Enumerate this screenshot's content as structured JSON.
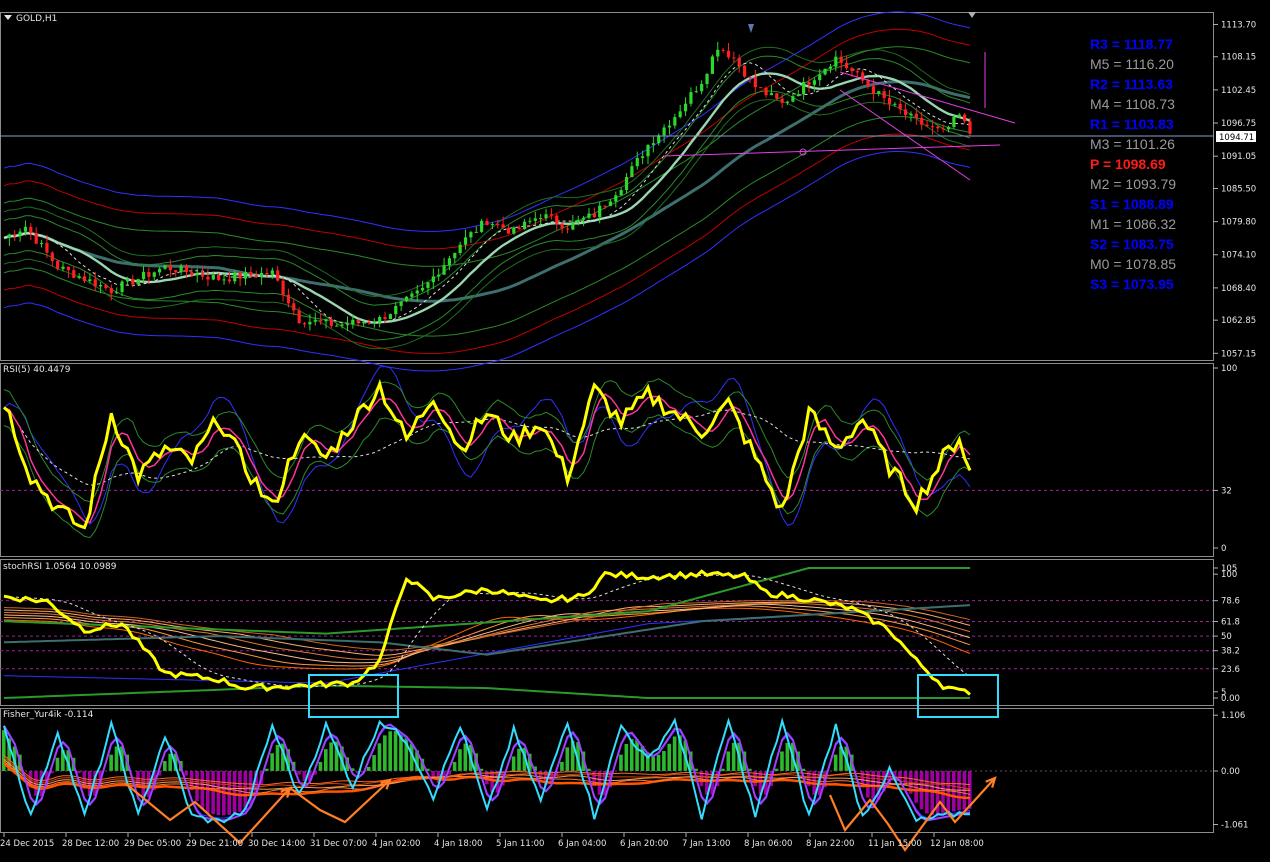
{
  "panes": {
    "main": {
      "title": "GOLD,H1",
      "price_label": "1094.71"
    },
    "rsi": {
      "title": "RSI(5) 40.4479"
    },
    "stoch": {
      "title": "stochRSI 1.0564 10.0989"
    },
    "fisher": {
      "title": "Fisher_Yur4ik -0.114"
    }
  },
  "pivots": [
    {
      "label": "R3 = 1118.77",
      "color": "#0000ff"
    },
    {
      "label": "M5 = 1116.20",
      "color": "#9a9a9a"
    },
    {
      "label": "R2 = 1113.63",
      "color": "#0000ff"
    },
    {
      "label": "M4 = 1108.73",
      "color": "#9a9a9a"
    },
    {
      "label": "R1 = 1103.83",
      "color": "#0000ff"
    },
    {
      "label": "M3 = 1101.26",
      "color": "#9a9a9a"
    },
    {
      "label": "P  = 1098.69",
      "color": "#ff1a1a"
    },
    {
      "label": "M2 = 1093.79",
      "color": "#9a9a9a"
    },
    {
      "label": "S1 = 1088.89",
      "color": "#0000ff"
    },
    {
      "label": "M1 = 1086.32",
      "color": "#9a9a9a"
    },
    {
      "label": "S2 = 1083.75",
      "color": "#0000ff"
    },
    {
      "label": "M0 = 1078.85",
      "color": "#9a9a9a"
    },
    {
      "label": "S3 = 1073.95",
      "color": "#0000ff"
    }
  ],
  "chart_data": {
    "type": "candlestick",
    "symbol": "GOLD",
    "timeframe": "H1",
    "colors": {
      "up": "#2bd82b",
      "down": "#ff2020",
      "rsi": "#ffff00",
      "fisher_line": "#33ddff",
      "hist_pos": "#2eb82e",
      "hist_neg": "#a000a0",
      "arrow": "#ff7f27",
      "box": "#33ddff"
    },
    "x_labels": [
      "24 Dec 2015",
      "28 Dec 12:00",
      "29 Dec 05:00",
      "29 Dec 21:00",
      "30 Dec 14:00",
      "31 Dec 07:00",
      "4 Jan 02:00",
      "4 Jan 18:00",
      "5 Jan 11:00",
      "6 Jan 04:00",
      "6 Jan 20:00",
      "7 Jan 13:00",
      "8 Jan 06:00",
      "8 Jan 22:00",
      "11 Jan 15:00",
      "12 Jan 08:00"
    ],
    "price_axis": {
      "ticks": [
        "1113.70",
        "1108.15",
        "1102.45",
        "1096.75",
        "1091.05",
        "1085.50",
        "1079.80",
        "1074.10",
        "1068.40",
        "1062.85",
        "1057.15"
      ],
      "range": [
        1056.0,
        1115.5
      ]
    },
    "price_path": [
      [
        0,
        1077
      ],
      [
        4,
        1079
      ],
      [
        10,
        1072
      ],
      [
        20,
        1068
      ],
      [
        30,
        1072
      ],
      [
        40,
        1070
      ],
      [
        50,
        1071
      ],
      [
        55,
        1063
      ],
      [
        62,
        1062
      ],
      [
        70,
        1063
      ],
      [
        78,
        1068
      ],
      [
        85,
        1076
      ],
      [
        90,
        1080
      ],
      [
        95,
        1078
      ],
      [
        100,
        1081
      ],
      [
        105,
        1079
      ],
      [
        110,
        1081
      ],
      [
        115,
        1086
      ],
      [
        120,
        1093
      ],
      [
        125,
        1098
      ],
      [
        130,
        1104
      ],
      [
        133,
        1110
      ],
      [
        136,
        1108
      ],
      [
        140,
        1103
      ],
      [
        145,
        1100
      ],
      [
        150,
        1104
      ],
      [
        155,
        1108
      ],
      [
        160,
        1104
      ],
      [
        165,
        1100
      ],
      [
        170,
        1097
      ],
      [
        175,
        1095
      ],
      [
        178,
        1098
      ],
      [
        180,
        1095
      ]
    ],
    "rsi": {
      "ticks": [
        "100",
        "32",
        "0"
      ],
      "range": [
        0,
        100
      ],
      "level": 32,
      "path": [
        [
          0,
          82
        ],
        [
          5,
          40
        ],
        [
          10,
          22
        ],
        [
          15,
          10
        ],
        [
          20,
          75
        ],
        [
          25,
          40
        ],
        [
          30,
          55
        ],
        [
          35,
          48
        ],
        [
          40,
          72
        ],
        [
          45,
          45
        ],
        [
          50,
          22
        ],
        [
          55,
          62
        ],
        [
          60,
          50
        ],
        [
          65,
          70
        ],
        [
          70,
          90
        ],
        [
          75,
          60
        ],
        [
          80,
          85
        ],
        [
          85,
          55
        ],
        [
          90,
          75
        ],
        [
          95,
          60
        ],
        [
          100,
          70
        ],
        [
          105,
          40
        ],
        [
          110,
          88
        ],
        [
          115,
          70
        ],
        [
          120,
          85
        ],
        [
          125,
          75
        ],
        [
          130,
          65
        ],
        [
          135,
          80
        ],
        [
          140,
          50
        ],
        [
          145,
          20
        ],
        [
          150,
          75
        ],
        [
          155,
          55
        ],
        [
          160,
          72
        ],
        [
          165,
          45
        ],
        [
          170,
          25
        ],
        [
          175,
          50
        ],
        [
          178,
          62
        ],
        [
          180,
          42
        ]
      ]
    },
    "stoch_rsi": {
      "ticks": [
        "105",
        "100",
        "78.6",
        "61.8",
        "50",
        "38.2",
        "23.6",
        "5",
        "0.00"
      ],
      "range": [
        0,
        105
      ],
      "path": [
        [
          0,
          82
        ],
        [
          8,
          78
        ],
        [
          15,
          55
        ],
        [
          22,
          60
        ],
        [
          30,
          20
        ],
        [
          40,
          15
        ],
        [
          45,
          8
        ],
        [
          55,
          10
        ],
        [
          65,
          12
        ],
        [
          70,
          30
        ],
        [
          75,
          98
        ],
        [
          80,
          80
        ],
        [
          90,
          88
        ],
        [
          100,
          78
        ],
        [
          108,
          82
        ],
        [
          112,
          100
        ],
        [
          120,
          98
        ],
        [
          130,
          100
        ],
        [
          138,
          98
        ],
        [
          142,
          85
        ],
        [
          150,
          80
        ],
        [
          158,
          72
        ],
        [
          165,
          55
        ],
        [
          170,
          30
        ],
        [
          175,
          10
        ],
        [
          178,
          5
        ]
      ]
    },
    "fisher": {
      "ticks": [
        "1.106",
        "0.00",
        "-1.061"
      ],
      "range": [
        -1.15,
        1.15
      ],
      "path": [
        [
          0,
          0.9
        ],
        [
          5,
          -0.9
        ],
        [
          10,
          0.8
        ],
        [
          15,
          -0.9
        ],
        [
          20,
          0.9
        ],
        [
          25,
          -0.9
        ],
        [
          30,
          0.7
        ],
        [
          35,
          -0.9
        ],
        [
          40,
          -1.0
        ],
        [
          45,
          -0.8
        ],
        [
          50,
          0.9
        ],
        [
          55,
          -0.5
        ],
        [
          60,
          0.9
        ],
        [
          65,
          -0.3
        ],
        [
          70,
          1.0
        ],
        [
          75,
          0.6
        ],
        [
          80,
          -0.5
        ],
        [
          85,
          0.9
        ],
        [
          90,
          -0.8
        ],
        [
          95,
          0.8
        ],
        [
          100,
          -0.6
        ],
        [
          105,
          1.0
        ],
        [
          110,
          -0.9
        ],
        [
          115,
          0.9
        ],
        [
          120,
          0.2
        ],
        [
          125,
          1.0
        ],
        [
          130,
          -0.9
        ],
        [
          135,
          1.0
        ],
        [
          140,
          -0.9
        ],
        [
          145,
          1.0
        ],
        [
          150,
          -0.9
        ],
        [
          155,
          0.9
        ],
        [
          160,
          -0.9
        ],
        [
          165,
          0.0
        ],
        [
          170,
          -1.0
        ],
        [
          175,
          -0.9
        ],
        [
          180,
          -0.8
        ]
      ]
    }
  }
}
